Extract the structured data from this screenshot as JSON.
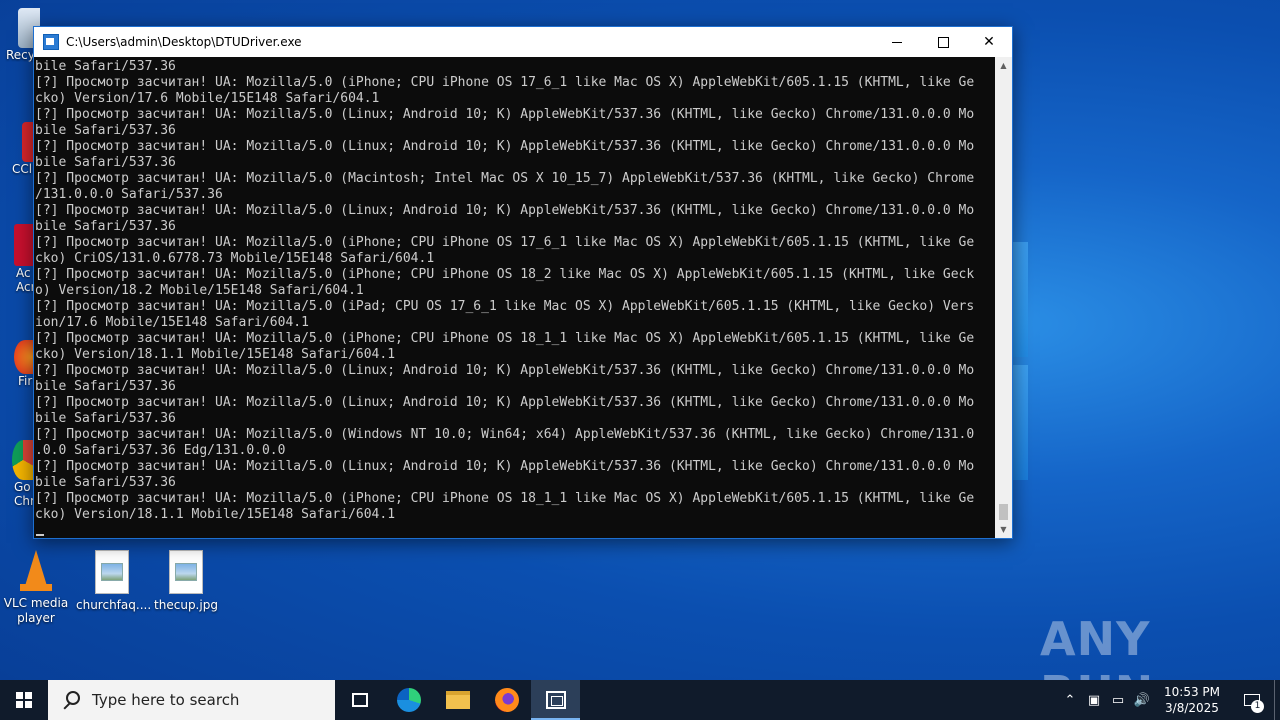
{
  "desktop": {
    "icons": [
      {
        "label": "Recycle Bin",
        "visible": "Recycl"
      },
      {
        "label": "CCleaner",
        "visible": "CCl"
      },
      {
        "label": "Adobe Acrobat",
        "visible": "Ac\nAcr"
      },
      {
        "label": "Firefox",
        "visible": "Fir"
      },
      {
        "label": "Google Chrome",
        "visible": "Go\nChr"
      }
    ],
    "files": [
      {
        "label": "VLC media player"
      },
      {
        "label": "churchfaq...."
      },
      {
        "label": "thecup.jpg"
      }
    ]
  },
  "window": {
    "title": "C:\\Users\\admin\\Desktop\\DTUDriver.exe",
    "minimize": "—",
    "maximize": "☐",
    "close": "✕",
    "console_lines": [
      "bile Safari/537.36",
      "[?] Просмотр засчитан! UA: Mozilla/5.0 (iPhone; CPU iPhone OS 17_6_1 like Mac OS X) AppleWebKit/605.1.15 (KHTML, like Ge",
      "cko) Version/17.6 Mobile/15E148 Safari/604.1",
      "[?] Просмотр засчитан! UA: Mozilla/5.0 (Linux; Android 10; K) AppleWebKit/537.36 (KHTML, like Gecko) Chrome/131.0.0.0 Mo",
      "bile Safari/537.36",
      "[?] Просмотр засчитан! UA: Mozilla/5.0 (Linux; Android 10; K) AppleWebKit/537.36 (KHTML, like Gecko) Chrome/131.0.0.0 Mo",
      "bile Safari/537.36",
      "[?] Просмотр засчитан! UA: Mozilla/5.0 (Macintosh; Intel Mac OS X 10_15_7) AppleWebKit/537.36 (KHTML, like Gecko) Chrome",
      "/131.0.0.0 Safari/537.36",
      "[?] Просмотр засчитан! UA: Mozilla/5.0 (Linux; Android 10; K) AppleWebKit/537.36 (KHTML, like Gecko) Chrome/131.0.0.0 Mo",
      "bile Safari/537.36",
      "[?] Просмотр засчитан! UA: Mozilla/5.0 (iPhone; CPU iPhone OS 17_6_1 like Mac OS X) AppleWebKit/605.1.15 (KHTML, like Ge",
      "cko) CriOS/131.0.6778.73 Mobile/15E148 Safari/604.1",
      "[?] Просмотр засчитан! UA: Mozilla/5.0 (iPhone; CPU iPhone OS 18_2 like Mac OS X) AppleWebKit/605.1.15 (KHTML, like Geck",
      "o) Version/18.2 Mobile/15E148 Safari/604.1",
      "[?] Просмотр засчитан! UA: Mozilla/5.0 (iPad; CPU OS 17_6_1 like Mac OS X) AppleWebKit/605.1.15 (KHTML, like Gecko) Vers",
      "ion/17.6 Mobile/15E148 Safari/604.1",
      "[?] Просмотр засчитан! UA: Mozilla/5.0 (iPhone; CPU iPhone OS 18_1_1 like Mac OS X) AppleWebKit/605.1.15 (KHTML, like Ge",
      "cko) Version/18.1.1 Mobile/15E148 Safari/604.1",
      "[?] Просмотр засчитан! UA: Mozilla/5.0 (Linux; Android 10; K) AppleWebKit/537.36 (KHTML, like Gecko) Chrome/131.0.0.0 Mo",
      "bile Safari/537.36",
      "[?] Просмотр засчитан! UA: Mozilla/5.0 (Linux; Android 10; K) AppleWebKit/537.36 (KHTML, like Gecko) Chrome/131.0.0.0 Mo",
      "bile Safari/537.36",
      "[?] Просмотр засчитан! UA: Mozilla/5.0 (Windows NT 10.0; Win64; x64) AppleWebKit/537.36 (KHTML, like Gecko) Chrome/131.0",
      ".0.0 Safari/537.36 Edg/131.0.0.0",
      "[?] Просмотр засчитан! UA: Mozilla/5.0 (Linux; Android 10; K) AppleWebKit/537.36 (KHTML, like Gecko) Chrome/131.0.0.0 Mo",
      "bile Safari/537.36",
      "[?] Просмотр засчитан! UA: Mozilla/5.0 (iPhone; CPU iPhone OS 18_1_1 like Mac OS X) AppleWebKit/605.1.15 (KHTML, like Ge",
      "cko) Version/18.1.1 Mobile/15E148 Safari/604.1"
    ]
  },
  "watermark": "ANY RUN",
  "taskbar": {
    "search_placeholder": "Type here to search",
    "time": "10:53 PM",
    "date": "3/8/2025",
    "notification_count": "1",
    "tray": {
      "chevron": "⌃",
      "meet": "▣",
      "network": "▭",
      "volume": "🔊"
    }
  },
  "colors": {
    "console_bg": "#0c0c0c",
    "console_fg": "#cccccc",
    "taskbar": "#101b2b",
    "accent": "#1d6fd0"
  }
}
